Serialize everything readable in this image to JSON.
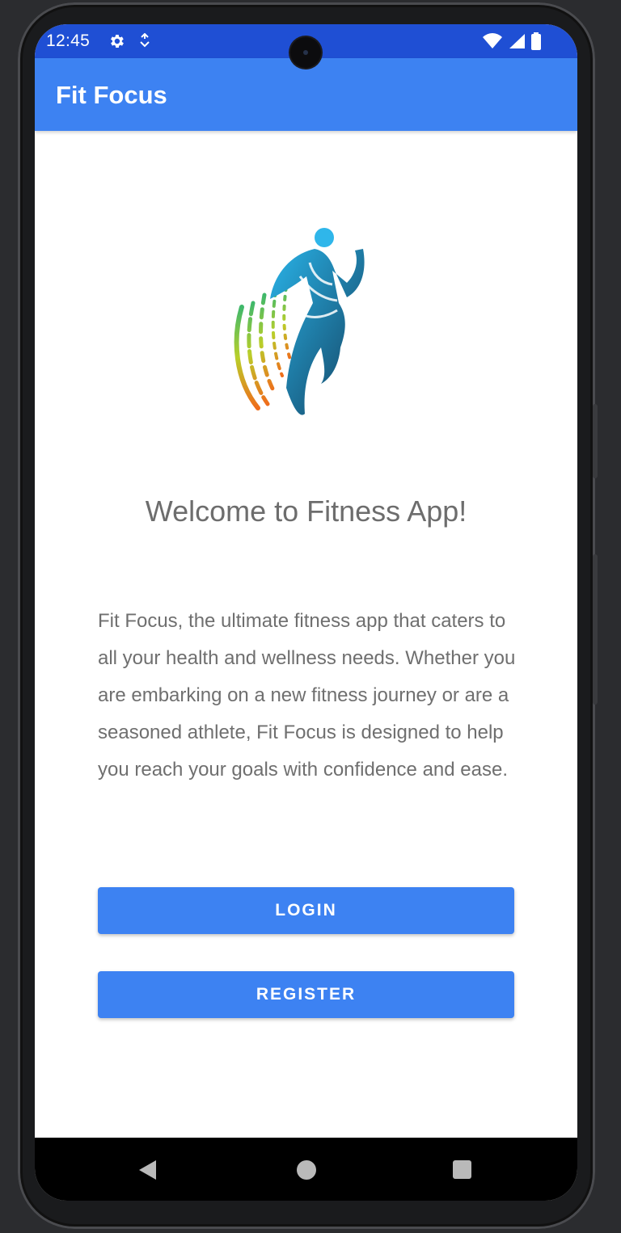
{
  "status_bar": {
    "time": "12:45",
    "icons": [
      "gear-icon",
      "navigation-arrow-icon",
      "wifi-icon",
      "signal-icon",
      "battery-icon"
    ]
  },
  "app_bar": {
    "title": "Fit Focus"
  },
  "main": {
    "welcome_heading": "Welcome to Fitness App!",
    "description": "Fit Focus, the ultimate fitness app that caters to all your health and wellness needs. Whether you are embarking on a new fitness journey or are a seasoned athlete, Fit Focus is designed to help you reach your goals with confidence and ease.",
    "login_label": "LOGIN",
    "register_label": "REGISTER"
  },
  "nav_bar": {
    "icons": [
      "back-icon",
      "home-icon",
      "recents-icon"
    ]
  },
  "colors": {
    "status_bar": "#1f4fd4",
    "primary": "#3d82f2",
    "text": "#6f6f6f"
  }
}
